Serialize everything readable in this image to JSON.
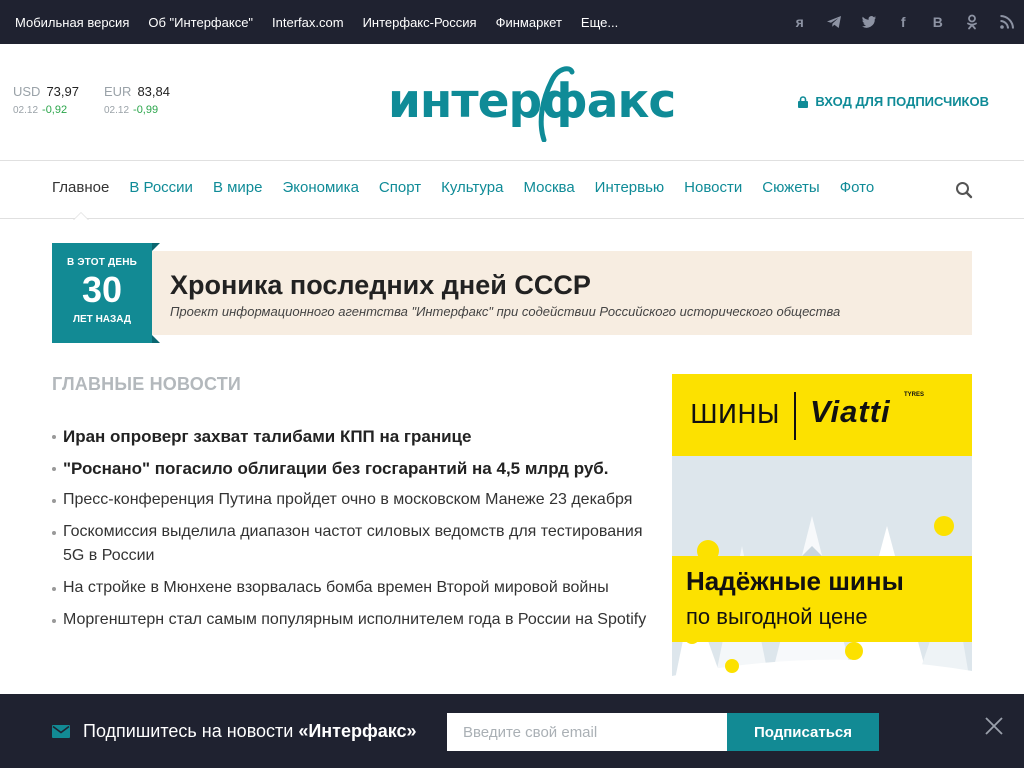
{
  "topbar": {
    "links": [
      "Мобильная версия",
      "Об \"Интерфаксе\"",
      "Interfax.com",
      "Интерфакс-Россия",
      "Финмаркет",
      "Еще..."
    ],
    "social": [
      {
        "name": "yandex-icon",
        "glyph": "я"
      },
      {
        "name": "telegram-icon"
      },
      {
        "name": "twitter-icon"
      },
      {
        "name": "facebook-icon",
        "glyph": "f"
      },
      {
        "name": "vk-icon",
        "glyph": "В"
      },
      {
        "name": "odnoklassniki-icon"
      },
      {
        "name": "rss-icon"
      }
    ]
  },
  "rates": [
    {
      "currency": "USD",
      "value": "73,97",
      "date": "02.12",
      "change": "-0,92"
    },
    {
      "currency": "EUR",
      "value": "83,84",
      "date": "02.12",
      "change": "-0,99"
    }
  ],
  "logo": {
    "text": "интерфакс"
  },
  "login": {
    "label": "ВХОД ДЛЯ ПОДПИСЧИКОВ"
  },
  "nav": {
    "items": [
      "Главное",
      "В России",
      "В мире",
      "Экономика",
      "Спорт",
      "Культура",
      "Москва",
      "Интервью",
      "Новости",
      "Сюжеты",
      "Фото"
    ],
    "active_index": 0
  },
  "banner": {
    "line1": "В ЭТОТ ДЕНЬ",
    "number": "30",
    "line3": "ЛЕТ НАЗАД",
    "title": "Хроника последних дней СССР",
    "subtitle": "Проект информационного агентства \"Интерфакс\" при содействии Российского исторического общества"
  },
  "main_news": {
    "title": "ГЛАВНЫЕ НОВОСТИ",
    "items": [
      {
        "text": "Иран опроверг захват талибами КПП на границе",
        "bold": true
      },
      {
        "text": "\"Роснано\" погасило облигации без госгарантий на 4,5 млрд руб.",
        "bold": true
      },
      {
        "text": "Пресс-конференция Путина пройдет очно в московском Манеже 23 декабря",
        "bold": false
      },
      {
        "text": "Госкомиссия выделила диапазон частот силовых ведомств для тестирования 5G в России",
        "bold": false
      },
      {
        "text": "На стройке в Мюнхене взорвалась бомба времен Второй мировой войны",
        "bold": false
      },
      {
        "text": "Моргенштерн стал самым популярным исполнителем года в России на Spotify",
        "bold": false
      }
    ]
  },
  "ad": {
    "label": "ШИНЫ",
    "brand": "Viatti",
    "brand_small": "TYRES",
    "headline": "Надёжные шины",
    "subline": "по выгодной цене",
    "colors": {
      "yellow": "#fce100"
    }
  },
  "subscribe": {
    "text_prefix": "Подпишитесь на новости ",
    "text_brand": "«Интерфакс»",
    "placeholder": "Введите свой email",
    "button": "Подписаться"
  },
  "colors": {
    "accent": "#0f8b97",
    "dark": "#1f2230",
    "positive": "#2aa54a"
  }
}
